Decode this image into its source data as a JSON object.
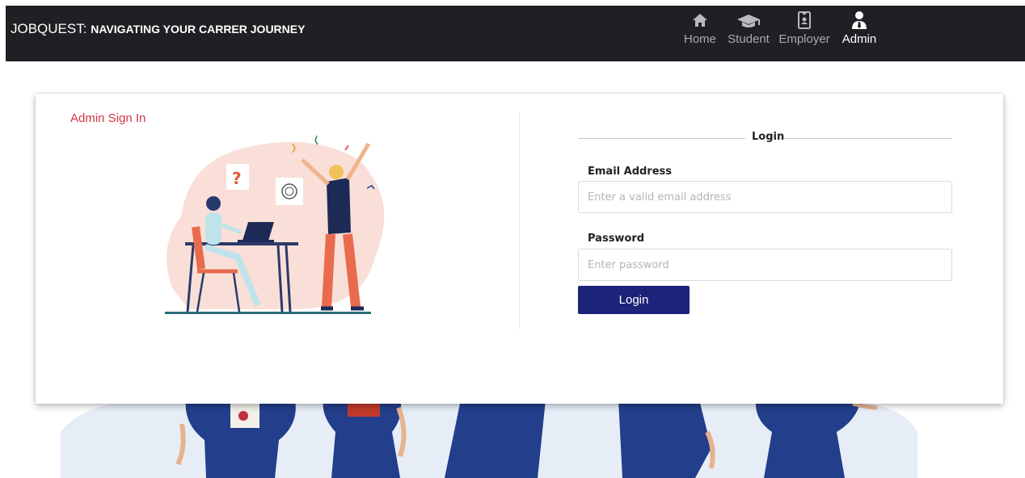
{
  "navbar": {
    "brand_main": "JOBQUEST:",
    "brand_sub": "NAVIGATING YOUR CARRER JOURNEY",
    "items": [
      {
        "label": "Home",
        "icon": "home-icon"
      },
      {
        "label": "Student",
        "icon": "graduation-cap-icon"
      },
      {
        "label": "Employer",
        "icon": "id-badge-icon"
      },
      {
        "label": "Admin",
        "icon": "user-tie-icon"
      }
    ],
    "active_item": "Admin"
  },
  "card": {
    "title": "Admin Sign In"
  },
  "login_form": {
    "legend": "Login",
    "email_label": "Email Address",
    "email_placeholder": "Enter a valid email address",
    "password_label": "Password",
    "password_placeholder": "Enter password",
    "submit_label": "Login"
  },
  "colors": {
    "navbar_bg": "#1f2023",
    "accent_red": "#d0364a",
    "button_blue": "#1d2378"
  }
}
